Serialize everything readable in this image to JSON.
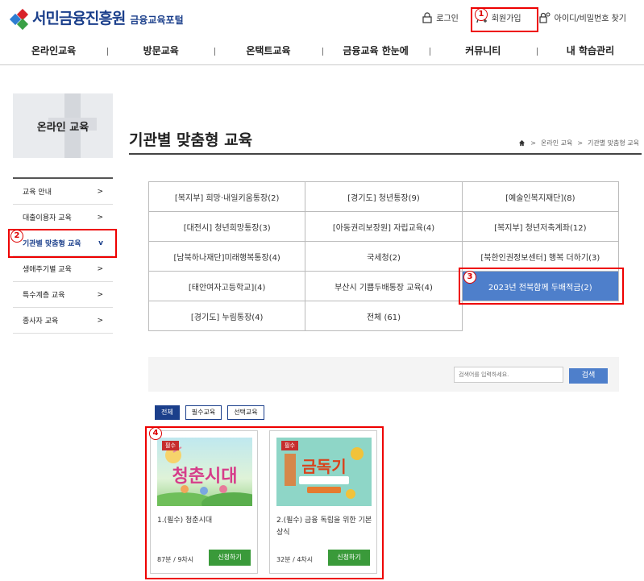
{
  "header": {
    "logo_text": "서민금융진흥원",
    "logo_sub": "금융교육포털",
    "util": [
      {
        "label": "로그인",
        "icon": "lock-icon"
      },
      {
        "label": "회원가입",
        "icon": "user-add-icon"
      },
      {
        "label": "아이디/비밀번호 찾기",
        "icon": "lock-search-icon"
      }
    ]
  },
  "gnb": [
    "온라인교육",
    "방문교육",
    "온택트교육",
    "금융교육 한눈에",
    "커뮤니티",
    "내 학습관리"
  ],
  "sidebar": {
    "banner": "온라인 교육",
    "items": [
      {
        "label": "교육 안내",
        "arrow": ">"
      },
      {
        "label": "대출이용자 교육",
        "arrow": ">"
      },
      {
        "label": "기관별 맞춤형 교육",
        "arrow": "v"
      },
      {
        "label": "생애주기별 교육",
        "arrow": ">"
      },
      {
        "label": "특수계층 교육",
        "arrow": ">"
      },
      {
        "label": "종사자 교육",
        "arrow": ">"
      }
    ]
  },
  "main": {
    "title": "기관별 맞춤형 교육",
    "breadcrumb": [
      ">",
      "온라인 교육",
      ">",
      "기관별 맞춤형 교육"
    ],
    "categories": [
      "[복지부] 희망·내일키움통장(2)",
      "[경기도] 청년통장(9)",
      "[예술인복지재단](8)",
      "[대전시] 청년희망통장(3)",
      "[아동권리보장원] 자립교육(4)",
      "[복지부] 청년저축계좌(12)",
      "[남북하나재단]미래행복통장(4)",
      "국세청(2)",
      "[북한인권정보센터] 행복 더하기(3)",
      "[태안여자고등학교](4)",
      "부산시 기쁨두배통장 교육(4)",
      "2023년 전북함께 두배적금(2)",
      "[경기도] 누림통장(4)",
      "전체 (61)"
    ],
    "search": {
      "placeholder": "검색어를 입력하세요.",
      "button": "검색"
    },
    "filters": [
      "전체",
      "필수교육",
      "선택교육"
    ],
    "courses": [
      {
        "tag": "필수",
        "thumb_title": "청춘시대",
        "title": "1.(필수) 청춘시대",
        "meta": "87분 / 9차시",
        "button": "신청하기"
      },
      {
        "tag": "필수",
        "thumb_title": "금독기",
        "title": "2.(필수) 금융 독립을 위한 기본상식",
        "meta": "32분 / 4차시",
        "button": "신청하기"
      }
    ]
  },
  "annotations": [
    "1",
    "2",
    "3",
    "4"
  ],
  "colors": {
    "brand": "#1b3f8b",
    "highlight": "#4e7fcb",
    "apply": "#3a9a3a",
    "annotation": "#e00000"
  }
}
